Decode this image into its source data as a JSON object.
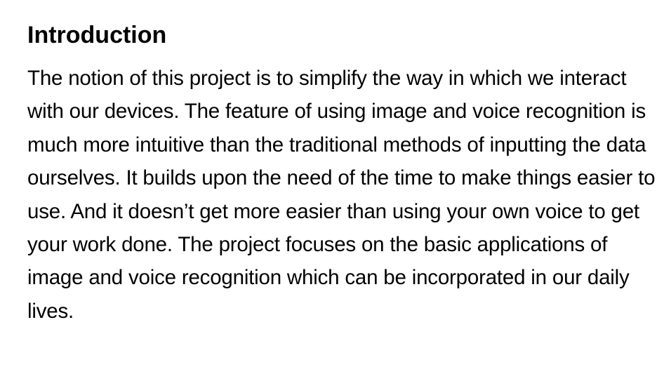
{
  "document": {
    "heading": "Introduction",
    "paragraph": "The notion of this project is to simplify the way in which we interact with our devices. The feature of using image and voice recognition is much more intuitive than the traditional methods of inputting the data ourselves. It builds upon the need of the time to make things easier to use. And it doesn’t get more easier than using your own voice to get your work done. The project focuses on the basic applications of image and voice recognition which can be incorporated in our daily lives."
  }
}
